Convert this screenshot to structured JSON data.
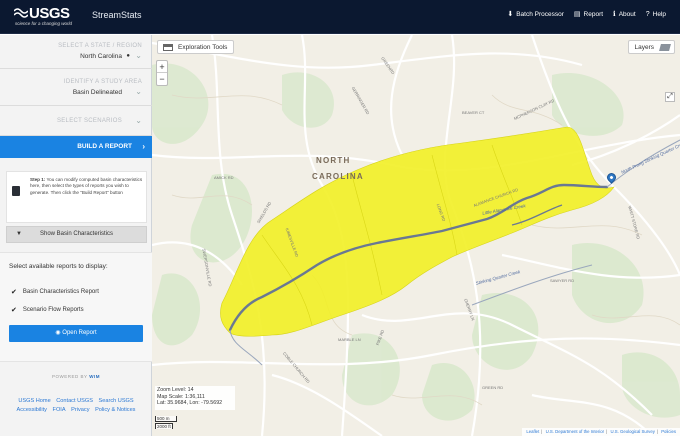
{
  "header": {
    "logo_text": "USGS",
    "logo_tagline": "science for a changing world",
    "app_title": "StreamStats",
    "nav": [
      {
        "icon": "download-icon",
        "glyph": "⬇",
        "label": "Batch Processor"
      },
      {
        "icon": "document-icon",
        "glyph": "▤",
        "label": "Report"
      },
      {
        "icon": "info-icon",
        "glyph": "ℹ",
        "label": "About"
      },
      {
        "icon": "question-icon",
        "glyph": "?",
        "label": "Help"
      }
    ]
  },
  "sidebar": {
    "step1": {
      "label": "SELECT A STATE / REGION",
      "value": "North Carolina"
    },
    "step2": {
      "label": "IDENTIFY A STUDY AREA",
      "value": "Basin Delineated"
    },
    "step3": {
      "label": "SELECT SCENARIOS"
    },
    "build_report": "BUILD A REPORT",
    "help": {
      "step": "Step 1:",
      "text": "You can modify computed basin characteristics here, then select the types of reports you wish to generate. Then click the \"Build Report\" button"
    },
    "show_basin": "Show Basin Characteristics",
    "reports": {
      "title": "Select available reports to display:",
      "options": [
        "Basin Characteristics Report",
        "Scenario Flow Reports"
      ],
      "open_button": "Open Report"
    },
    "powered_by": "POWERED BY",
    "powered_brand": "WIM",
    "footer_links": [
      "USGS Home",
      "Contact USGS",
      "Search USGS",
      "Accessibility",
      "FOIA",
      "Privacy",
      "Policy & Notices"
    ]
  },
  "map": {
    "exploration_tools": "Exploration Tools",
    "layers": "Layers",
    "zoom_in": "+",
    "zoom_out": "−",
    "expand_glyph": "⤢",
    "info": {
      "zoom": "Zoom Level: 14",
      "scale": "Map Scale: 1:36,111",
      "coords": "Lat: 35.9684, Lon: -79.5692"
    },
    "scale_bar": {
      "metric": "500 m",
      "imperial": "2000 ft"
    },
    "place_label_1": "NORTH",
    "place_label_2": "CAROLINA",
    "creek_labels": [
      "North Prong Stinking Quarter Creek",
      "Stinking Quarter Creek",
      "Little Alamance Creek"
    ],
    "road_labels": [
      "AMICK RD",
      "SHIELDS RD",
      "KIMESVILLE RD",
      "ALAMANCE CHURCH RD",
      "GERRINGER RD",
      "MARBLE LN",
      "SWEPSONVILLE RD",
      "COBLE CHURCH RD",
      "GREEN RD",
      "LONG RD",
      "PIKE RD",
      "SAWYER RD",
      "CHERRY LN",
      "WHITT STORE RD",
      "MCPHERSON CLAY RD",
      "BEAVER CT",
      "GREENRD"
    ],
    "attribution": [
      "Leaflet",
      "U.S. Department of the Interior",
      "U.S. Geological Survey",
      "Policies"
    ],
    "colors": {
      "basin_fill": "#f2ef25",
      "stream": "#6a7893",
      "road": "#ffffff",
      "background": "#f2efe6",
      "pin": "#2f78c4"
    }
  }
}
